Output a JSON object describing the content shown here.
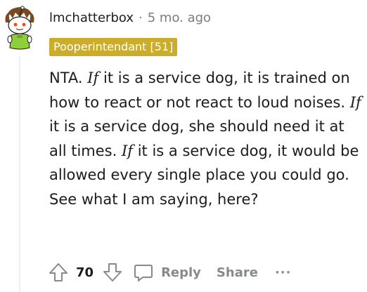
{
  "comment": {
    "author": "lmchatterbox",
    "separator": "·",
    "age": "5 mo. ago",
    "flair": "Pooperintendant [51]",
    "body": {
      "p1": "NTA. ",
      "if1": "If",
      "p2": " it is a service dog, it is trained on how to react or not react to loud noises. ",
      "if2": "If",
      "p3": " it is a service dog, she should need it at all times. ",
      "if3": "If",
      "p4": " it is a service dog, it would be allowed every single place you could go. See what I am saying, here?"
    },
    "votes": "70",
    "reply_label": "Reply",
    "share_label": "Share",
    "more_label": "···"
  },
  "icons": {
    "upvote": "upvote-arrow-icon",
    "downvote": "downvote-arrow-icon",
    "reply": "speech-bubble-icon",
    "avatar": "snoo-avatar"
  },
  "colors": {
    "flair_bg": "#ccac2b",
    "flair_text": "#ffffff",
    "muted_text": "#878a8c",
    "body_text": "#1c1c1c",
    "avatar_hat": "#7a4a1e",
    "avatar_body": "#8ccf3a"
  }
}
